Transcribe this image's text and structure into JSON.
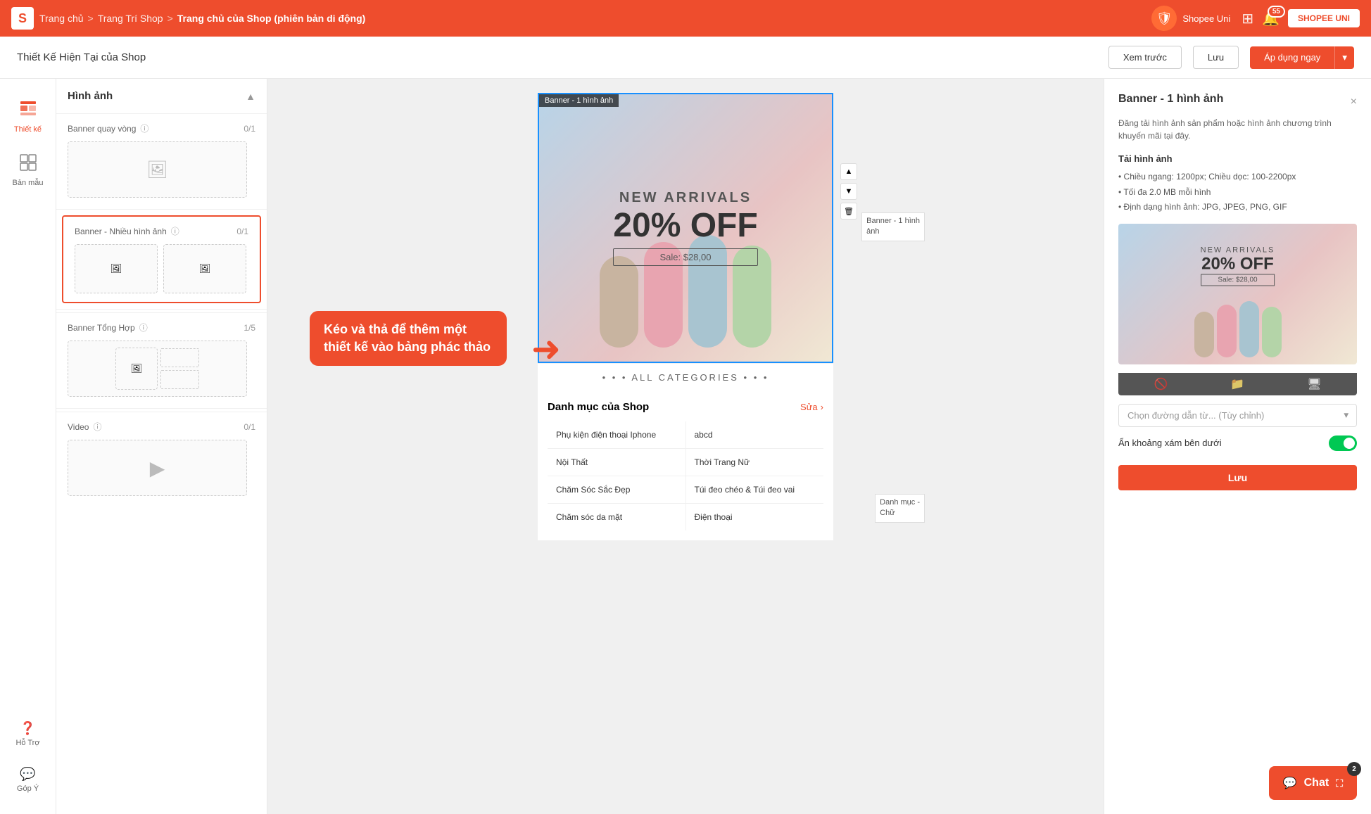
{
  "topnav": {
    "logo": "S",
    "breadcrumb": {
      "home": "Trang chủ",
      "sep1": ">",
      "shop_design": "Trang Trí Shop",
      "sep2": ">",
      "current": "Trang chủ của Shop (phiên bản di động)"
    },
    "shopee_uni": "Shopee Uni",
    "bell_badge": "55",
    "user": "SHOPEE UNI"
  },
  "toolbar": {
    "title": "Thiết Kế Hiện Tại của Shop",
    "preview": "Xem trước",
    "save": "Lưu",
    "apply": "Áp dụng ngay"
  },
  "sidebar": {
    "items": [
      {
        "id": "thiet-ke",
        "label": "Thiết kế",
        "icon": "🗂"
      },
      {
        "id": "ban-mau",
        "label": "Bản mẫu",
        "icon": "⬜"
      }
    ],
    "bottom": [
      {
        "id": "ho-tro",
        "label": "Hỗ Trợ"
      },
      {
        "id": "gop-y",
        "label": "Góp Ý"
      }
    ]
  },
  "panel": {
    "title": "Hình ảnh",
    "sections": [
      {
        "label": "Banner quay vòng",
        "count": "0/1",
        "has_help": true
      },
      {
        "label": "Banner - Nhiều hình ảnh",
        "count": "0/1",
        "has_help": true,
        "selected": true
      },
      {
        "label": "Banner Tổng Hợp",
        "count": "1/5",
        "has_help": true
      },
      {
        "label": "Video",
        "count": "0/1",
        "has_help": true
      }
    ]
  },
  "tooltip": "Kéo và thả để thêm một thiết kế vào bảng phác thảo",
  "canvas": {
    "banner_label": "Banner - 1 hình ảnh",
    "new_arrivals": "NEW ARRIVALS",
    "percent_off": "20% OFF",
    "sale_price": "Sale: $28,00",
    "all_categories": "ALL CATEGORIES",
    "shop_cats_title": "Danh mục của Shop",
    "shop_cats_edit": "Sửa",
    "categories": [
      {
        "left": "Phụ kiện điện thoại Iphone",
        "right": "abcd"
      },
      {
        "left": "Nội Thất",
        "right": "Thời Trang Nữ"
      },
      {
        "left": "Chăm Sóc Sắc Đẹp",
        "right": "Túi đeo chéo & Túi đeo vai"
      },
      {
        "left": "Chăm sóc da mặt",
        "right": "Điện thoại"
      }
    ],
    "side_labels": {
      "banner1_label": "Banner - 1 hình\nảnh",
      "danh_muc_label": "Danh mục -\nChữ"
    }
  },
  "right_panel": {
    "title": "Banner - 1 hình ảnh",
    "close": "×",
    "description": "Đăng tải hình ảnh sản phẩm hoặc hình ảnh chương trình khuyến mãi tại đây.",
    "upload_title": "Tải hình ảnh",
    "upload_rules": [
      "Chiều ngang: 1200px; Chiều dọc: 100-2200px",
      "Tối đa 2.0 MB mỗi hình",
      "Định dạng hình ảnh: JPG, JPEG, PNG, GIF"
    ],
    "select_placeholder": "Chọn đường dẫn từ... (Tùy chỉnh)",
    "toggle_label": "Ẩn khoảng xám bên dưới",
    "save_btn": "Lưu"
  },
  "chat": {
    "label": "Chat",
    "badge": "2"
  }
}
